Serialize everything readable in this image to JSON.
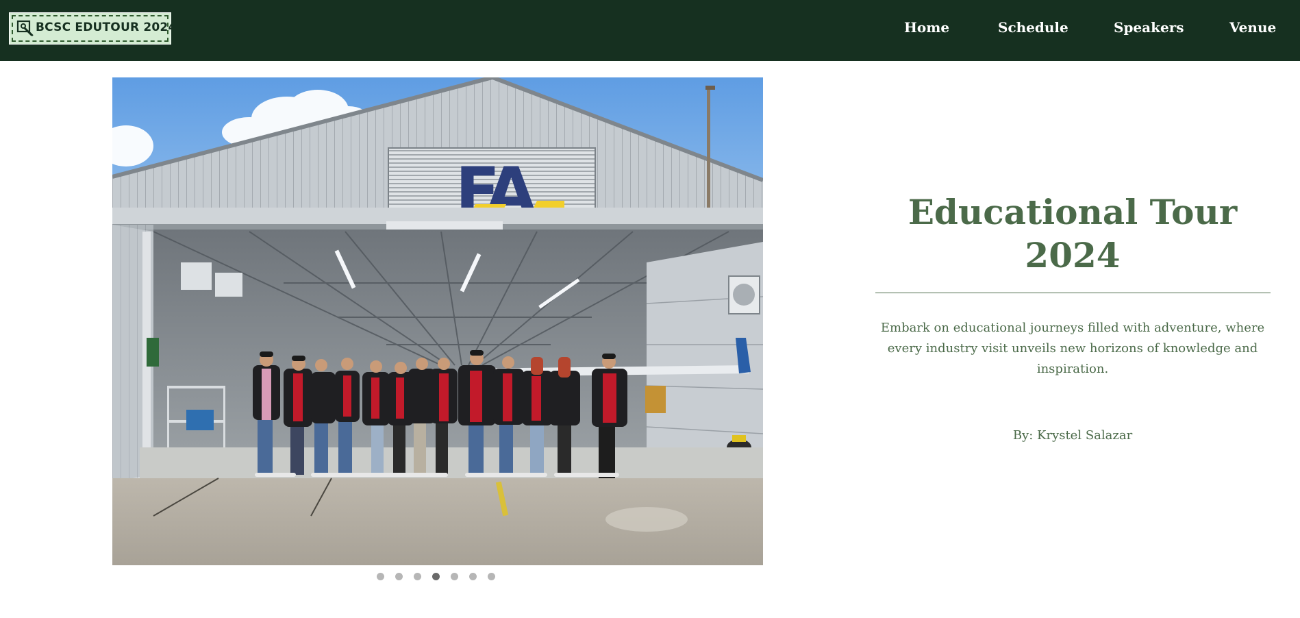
{
  "header": {
    "logo_text": "BCSC EDUTOUR 2024",
    "nav": [
      {
        "label": "Home"
      },
      {
        "label": "Schedule"
      },
      {
        "label": "Speakers"
      },
      {
        "label": "Venue"
      }
    ]
  },
  "slideshow": {
    "image_sign_text": "FA",
    "slide_count": 7,
    "active_slide": 4
  },
  "hero": {
    "title": "Educational Tour 2024",
    "description": "Embark on educational journeys filled with adventure, where every industry visit unveils new horizons of knowledge and inspiration.",
    "author": "By: Krystel Salazar"
  },
  "colors": {
    "header_bg": "#163020",
    "logo_bg": "#d4ecd3",
    "accent_green": "#4b6a49",
    "dot_inactive": "#b6b6b6",
    "dot_active": "#6a6a6a"
  }
}
